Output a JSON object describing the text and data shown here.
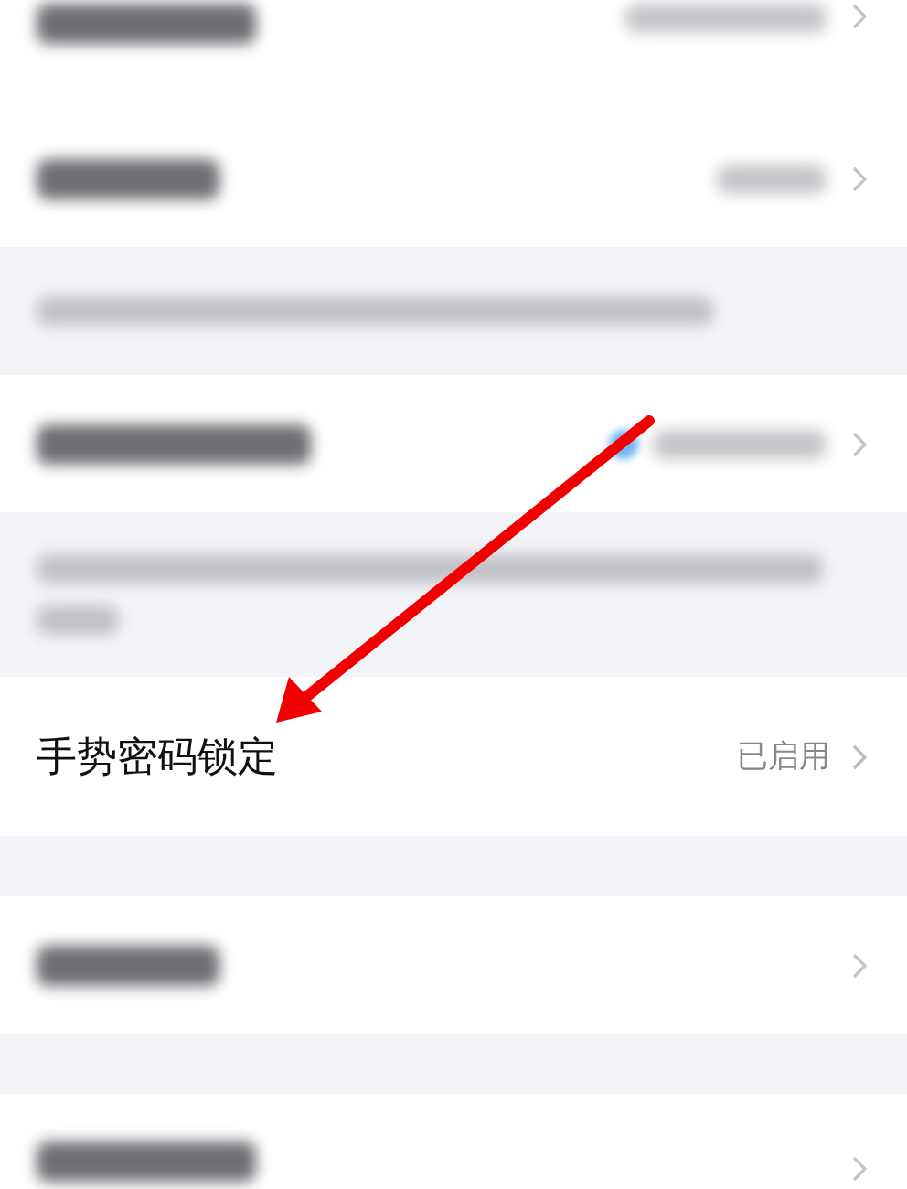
{
  "rows": [
    {
      "kind": "row",
      "blurred": true,
      "cut_top": true,
      "value_shown": true,
      "status_dot": false,
      "chevron": true
    },
    {
      "kind": "row",
      "blurred": true,
      "cut_top": false,
      "value_shown": true,
      "status_dot": false,
      "chevron": true
    },
    {
      "kind": "hint",
      "two_lines": false
    },
    {
      "kind": "row",
      "blurred": true,
      "cut_top": false,
      "value_shown": true,
      "status_dot": true,
      "chevron": true
    },
    {
      "kind": "hint",
      "two_lines": true
    },
    {
      "kind": "row",
      "blurred": false,
      "label": "手势密码锁定",
      "value": "已启用",
      "chevron": true
    },
    {
      "kind": "gap"
    },
    {
      "kind": "row",
      "blurred": true,
      "cut_top": false,
      "value_shown": false,
      "status_dot": false,
      "chevron": true
    },
    {
      "kind": "gap"
    },
    {
      "kind": "row",
      "blurred": true,
      "cut_top": false,
      "value_shown": false,
      "status_dot": false,
      "chevron": true
    }
  ],
  "annotation": {
    "kind": "arrow"
  }
}
